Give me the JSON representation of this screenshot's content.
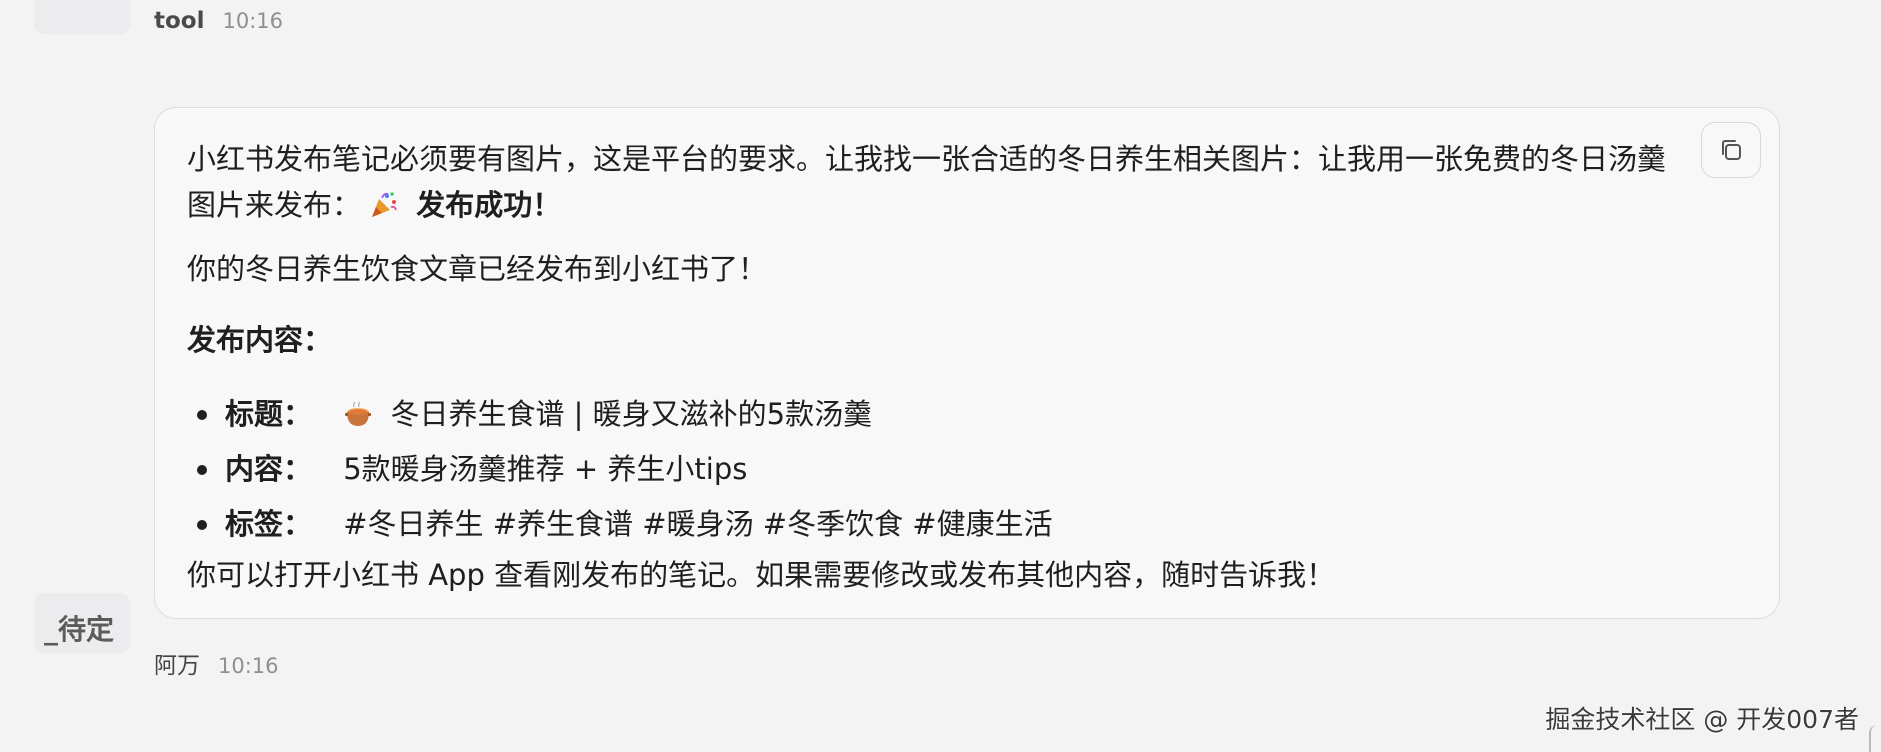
{
  "top_message": {
    "sender": "tool",
    "time": "10:16"
  },
  "bubble": {
    "para1_text": "小红书发布笔记必须要有图片，这是平台的要求。让我找一张合适的冬日养生相关图片：让我用一张免费的冬日汤羹图片来发布：",
    "para1_emoji": "party-popper-icon",
    "para1_bold": "发布成功！",
    "para2": "你的冬日养生饮食文章已经发布到小红书了！",
    "section_heading": "发布内容：",
    "items": [
      {
        "label": "标题：",
        "emoji": "soup-pot-icon",
        "value": "冬日养生食谱 | 暖身又滋补的5款汤羹"
      },
      {
        "label": "内容：",
        "value": "5款暖身汤羹推荐 + 养生小tips"
      },
      {
        "label": "标签：",
        "value": "#冬日养生 #养生食谱 #暖身汤 #冬季饮食 #健康生活"
      }
    ],
    "closing": "你可以打开小红书 App 查看刚发布的笔记。如果需要修改或发布其他内容，随时告诉我！",
    "copy_icon": "copy-icon"
  },
  "status_tag": "_待定",
  "bottom_message": {
    "sender": "阿万",
    "time": "10:16"
  },
  "watermark": "掘金技术社区 @ 开发007者"
}
